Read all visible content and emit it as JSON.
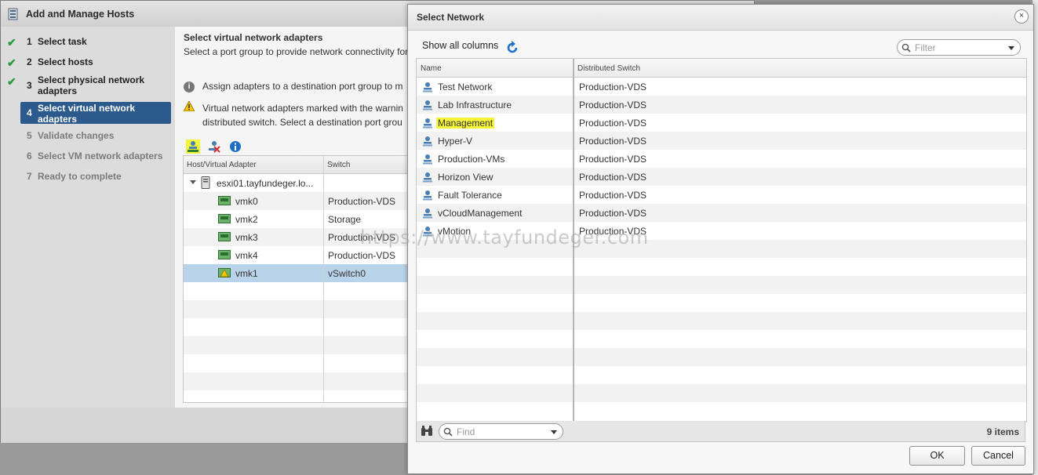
{
  "wizard": {
    "title": "Add and Manage Hosts",
    "steps": [
      {
        "num": "1",
        "label": "Select task",
        "state": "done"
      },
      {
        "num": "2",
        "label": "Select hosts",
        "state": "done"
      },
      {
        "num": "3",
        "label": "Select physical network adapters",
        "state": "done"
      },
      {
        "num": "4",
        "label": "Select virtual network adapters",
        "state": "active"
      },
      {
        "num": "5",
        "label": "Validate changes",
        "state": "todo"
      },
      {
        "num": "6",
        "label": "Select VM network adapters",
        "state": "todo"
      },
      {
        "num": "7",
        "label": "Ready to complete",
        "state": "todo"
      }
    ],
    "page_heading": "Select virtual network adapters",
    "page_subheading": "Select a port group to provide network connectivity for",
    "info_text": "Assign adapters to a destination port group to m",
    "warning_text_line1": "Virtual network adapters marked with the warnin",
    "warning_text_line2": "distributed switch. Select a destination port grou",
    "grid": {
      "columns": [
        "Host/Virtual Adapter",
        "Switch"
      ],
      "host": "esxi01.tayfundeger.lo...",
      "rows": [
        {
          "adapter": "vmk0",
          "switch": "Production-VDS"
        },
        {
          "adapter": "vmk2",
          "switch": "Storage"
        },
        {
          "adapter": "vmk3",
          "switch": "Production-VDS"
        },
        {
          "adapter": "vmk4",
          "switch": "Production-VDS"
        },
        {
          "adapter": "vmk1",
          "switch": "vSwitch0"
        }
      ]
    }
  },
  "dialog": {
    "title": "Select Network",
    "close_glyph": "×",
    "show_all_columns": "Show all columns",
    "filter_placeholder": "Filter",
    "columns": {
      "name": "Name",
      "switch": "Distributed Switch"
    },
    "networks": [
      {
        "name": "Test Network",
        "switch": "Production-VDS"
      },
      {
        "name": "Lab Infrastructure",
        "switch": "Production-VDS"
      },
      {
        "name": "Management",
        "switch": "Production-VDS",
        "highlighted": true
      },
      {
        "name": "Hyper-V",
        "switch": "Production-VDS"
      },
      {
        "name": "Production-VMs",
        "switch": "Production-VDS"
      },
      {
        "name": "Horizon View",
        "switch": "Production-VDS"
      },
      {
        "name": "Fault Tolerance",
        "switch": "Production-VDS"
      },
      {
        "name": "vCloudManagement",
        "switch": "Production-VDS"
      },
      {
        "name": "vMotion",
        "switch": "Production-VDS"
      }
    ],
    "find_placeholder": "Find",
    "item_count": "9 items",
    "ok_label": "OK",
    "cancel_label": "Cancel"
  },
  "watermark": "https://www.tayfundeger.com",
  "colors": {
    "active_step": "#2d5a8c",
    "highlight": "#f5f53a",
    "selected_row": "#b9d4ea",
    "check": "#2c9a3f"
  }
}
